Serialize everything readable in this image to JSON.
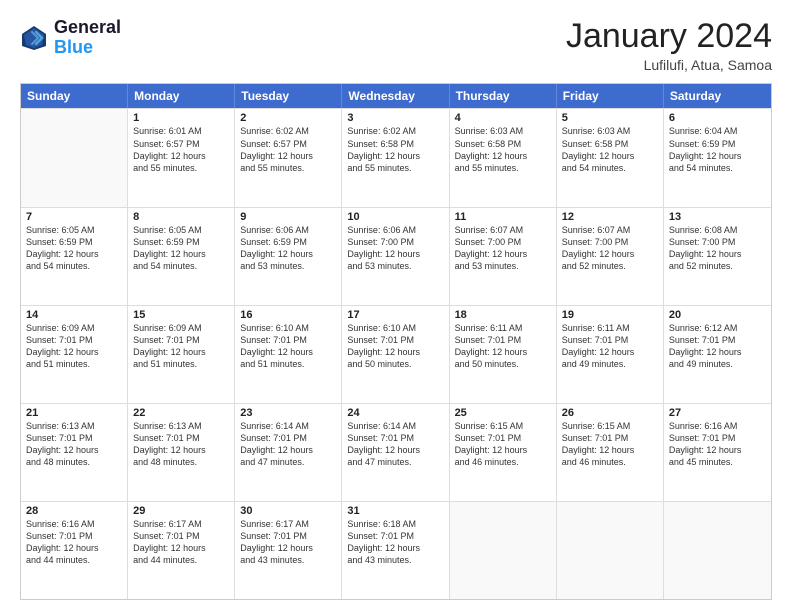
{
  "header": {
    "logo_line1": "General",
    "logo_line2": "Blue",
    "month_title": "January 2024",
    "location": "Lufilufi, Atua, Samoa"
  },
  "days_of_week": [
    "Sunday",
    "Monday",
    "Tuesday",
    "Wednesday",
    "Thursday",
    "Friday",
    "Saturday"
  ],
  "weeks": [
    [
      {
        "day": "",
        "lines": []
      },
      {
        "day": "1",
        "lines": [
          "Sunrise: 6:01 AM",
          "Sunset: 6:57 PM",
          "Daylight: 12 hours",
          "and 55 minutes."
        ]
      },
      {
        "day": "2",
        "lines": [
          "Sunrise: 6:02 AM",
          "Sunset: 6:57 PM",
          "Daylight: 12 hours",
          "and 55 minutes."
        ]
      },
      {
        "day": "3",
        "lines": [
          "Sunrise: 6:02 AM",
          "Sunset: 6:58 PM",
          "Daylight: 12 hours",
          "and 55 minutes."
        ]
      },
      {
        "day": "4",
        "lines": [
          "Sunrise: 6:03 AM",
          "Sunset: 6:58 PM",
          "Daylight: 12 hours",
          "and 55 minutes."
        ]
      },
      {
        "day": "5",
        "lines": [
          "Sunrise: 6:03 AM",
          "Sunset: 6:58 PM",
          "Daylight: 12 hours",
          "and 54 minutes."
        ]
      },
      {
        "day": "6",
        "lines": [
          "Sunrise: 6:04 AM",
          "Sunset: 6:59 PM",
          "Daylight: 12 hours",
          "and 54 minutes."
        ]
      }
    ],
    [
      {
        "day": "7",
        "lines": [
          "Sunrise: 6:05 AM",
          "Sunset: 6:59 PM",
          "Daylight: 12 hours",
          "and 54 minutes."
        ]
      },
      {
        "day": "8",
        "lines": [
          "Sunrise: 6:05 AM",
          "Sunset: 6:59 PM",
          "Daylight: 12 hours",
          "and 54 minutes."
        ]
      },
      {
        "day": "9",
        "lines": [
          "Sunrise: 6:06 AM",
          "Sunset: 6:59 PM",
          "Daylight: 12 hours",
          "and 53 minutes."
        ]
      },
      {
        "day": "10",
        "lines": [
          "Sunrise: 6:06 AM",
          "Sunset: 7:00 PM",
          "Daylight: 12 hours",
          "and 53 minutes."
        ]
      },
      {
        "day": "11",
        "lines": [
          "Sunrise: 6:07 AM",
          "Sunset: 7:00 PM",
          "Daylight: 12 hours",
          "and 53 minutes."
        ]
      },
      {
        "day": "12",
        "lines": [
          "Sunrise: 6:07 AM",
          "Sunset: 7:00 PM",
          "Daylight: 12 hours",
          "and 52 minutes."
        ]
      },
      {
        "day": "13",
        "lines": [
          "Sunrise: 6:08 AM",
          "Sunset: 7:00 PM",
          "Daylight: 12 hours",
          "and 52 minutes."
        ]
      }
    ],
    [
      {
        "day": "14",
        "lines": [
          "Sunrise: 6:09 AM",
          "Sunset: 7:01 PM",
          "Daylight: 12 hours",
          "and 51 minutes."
        ]
      },
      {
        "day": "15",
        "lines": [
          "Sunrise: 6:09 AM",
          "Sunset: 7:01 PM",
          "Daylight: 12 hours",
          "and 51 minutes."
        ]
      },
      {
        "day": "16",
        "lines": [
          "Sunrise: 6:10 AM",
          "Sunset: 7:01 PM",
          "Daylight: 12 hours",
          "and 51 minutes."
        ]
      },
      {
        "day": "17",
        "lines": [
          "Sunrise: 6:10 AM",
          "Sunset: 7:01 PM",
          "Daylight: 12 hours",
          "and 50 minutes."
        ]
      },
      {
        "day": "18",
        "lines": [
          "Sunrise: 6:11 AM",
          "Sunset: 7:01 PM",
          "Daylight: 12 hours",
          "and 50 minutes."
        ]
      },
      {
        "day": "19",
        "lines": [
          "Sunrise: 6:11 AM",
          "Sunset: 7:01 PM",
          "Daylight: 12 hours",
          "and 49 minutes."
        ]
      },
      {
        "day": "20",
        "lines": [
          "Sunrise: 6:12 AM",
          "Sunset: 7:01 PM",
          "Daylight: 12 hours",
          "and 49 minutes."
        ]
      }
    ],
    [
      {
        "day": "21",
        "lines": [
          "Sunrise: 6:13 AM",
          "Sunset: 7:01 PM",
          "Daylight: 12 hours",
          "and 48 minutes."
        ]
      },
      {
        "day": "22",
        "lines": [
          "Sunrise: 6:13 AM",
          "Sunset: 7:01 PM",
          "Daylight: 12 hours",
          "and 48 minutes."
        ]
      },
      {
        "day": "23",
        "lines": [
          "Sunrise: 6:14 AM",
          "Sunset: 7:01 PM",
          "Daylight: 12 hours",
          "and 47 minutes."
        ]
      },
      {
        "day": "24",
        "lines": [
          "Sunrise: 6:14 AM",
          "Sunset: 7:01 PM",
          "Daylight: 12 hours",
          "and 47 minutes."
        ]
      },
      {
        "day": "25",
        "lines": [
          "Sunrise: 6:15 AM",
          "Sunset: 7:01 PM",
          "Daylight: 12 hours",
          "and 46 minutes."
        ]
      },
      {
        "day": "26",
        "lines": [
          "Sunrise: 6:15 AM",
          "Sunset: 7:01 PM",
          "Daylight: 12 hours",
          "and 46 minutes."
        ]
      },
      {
        "day": "27",
        "lines": [
          "Sunrise: 6:16 AM",
          "Sunset: 7:01 PM",
          "Daylight: 12 hours",
          "and 45 minutes."
        ]
      }
    ],
    [
      {
        "day": "28",
        "lines": [
          "Sunrise: 6:16 AM",
          "Sunset: 7:01 PM",
          "Daylight: 12 hours",
          "and 44 minutes."
        ]
      },
      {
        "day": "29",
        "lines": [
          "Sunrise: 6:17 AM",
          "Sunset: 7:01 PM",
          "Daylight: 12 hours",
          "and 44 minutes."
        ]
      },
      {
        "day": "30",
        "lines": [
          "Sunrise: 6:17 AM",
          "Sunset: 7:01 PM",
          "Daylight: 12 hours",
          "and 43 minutes."
        ]
      },
      {
        "day": "31",
        "lines": [
          "Sunrise: 6:18 AM",
          "Sunset: 7:01 PM",
          "Daylight: 12 hours",
          "and 43 minutes."
        ]
      },
      {
        "day": "",
        "lines": []
      },
      {
        "day": "",
        "lines": []
      },
      {
        "day": "",
        "lines": []
      }
    ]
  ]
}
